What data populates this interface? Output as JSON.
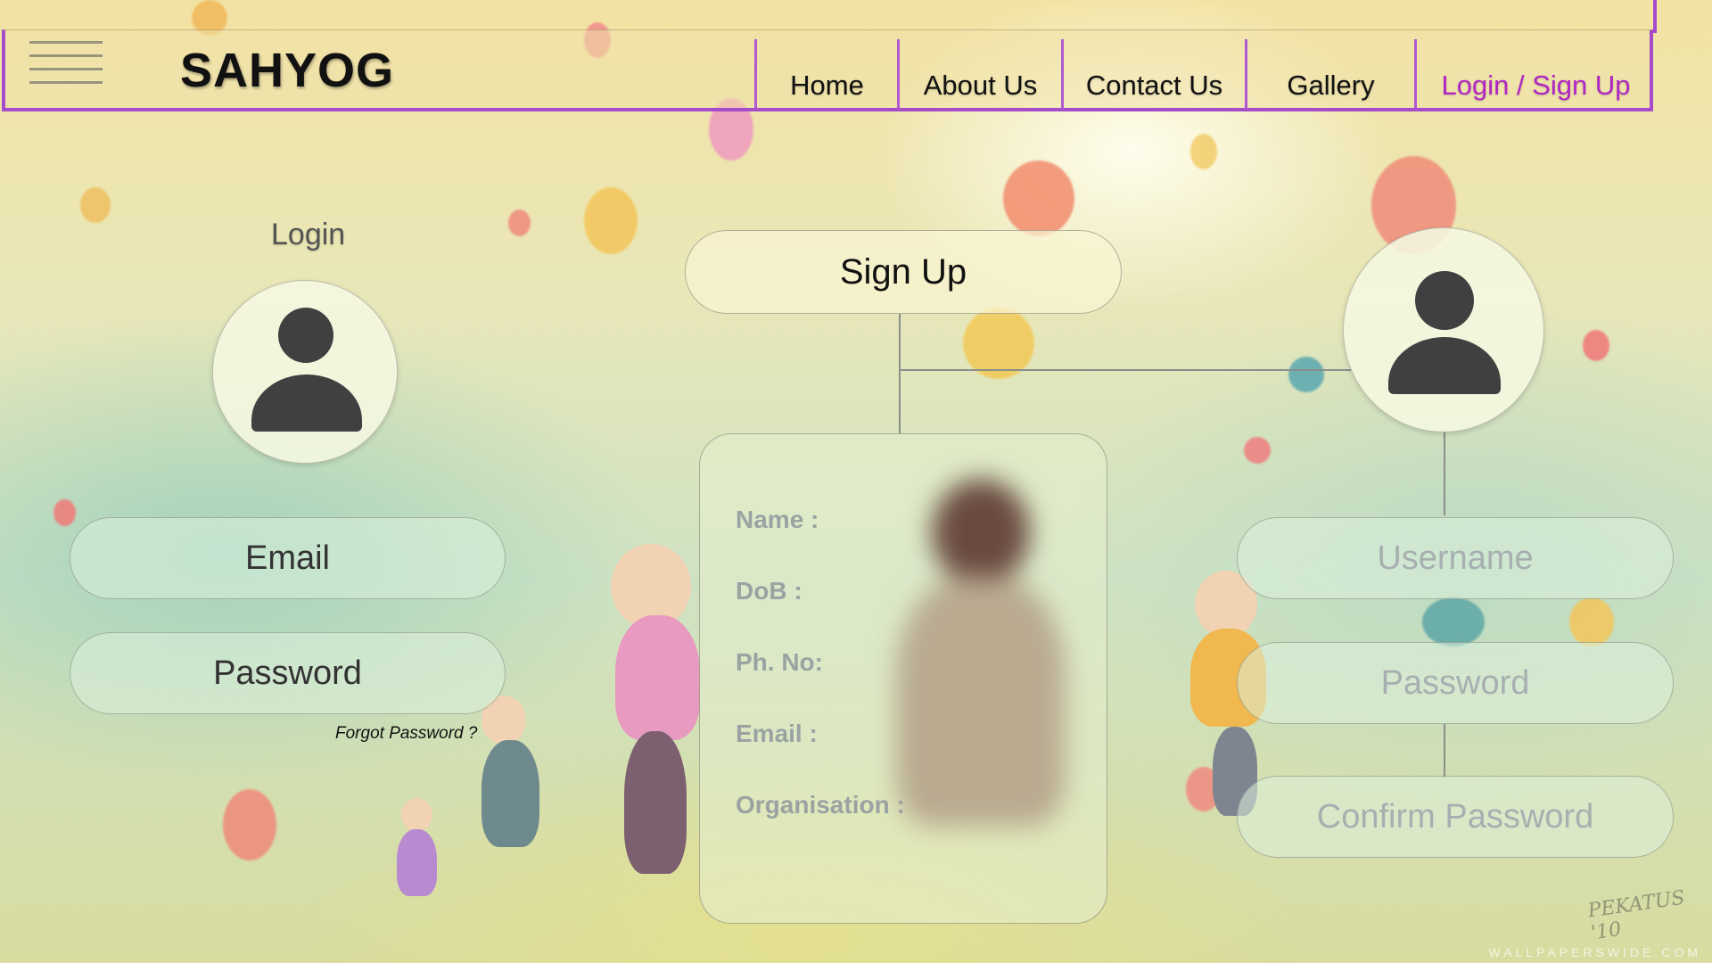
{
  "header": {
    "brand": "SAHYOG",
    "nav": [
      {
        "label": "Home"
      },
      {
        "label": "About Us"
      },
      {
        "label": "Contact Us"
      },
      {
        "label": "Gallery"
      },
      {
        "label": "Login / Sign Up",
        "active": true
      }
    ]
  },
  "login": {
    "title": "Login",
    "email_placeholder": "Email",
    "password_placeholder": "Password",
    "forgot_link": "Forgot Password ?"
  },
  "signup": {
    "title": "Sign Up",
    "fields": [
      {
        "label": "Name :"
      },
      {
        "label": "DoB     :"
      },
      {
        "label": "Ph. No:"
      },
      {
        "label": "Email  :"
      },
      {
        "label": "Organisation :"
      }
    ],
    "username_placeholder": "Username",
    "password_placeholder": "Password",
    "confirm_placeholder": "Confirm Password"
  },
  "background": {
    "watermark": "WALLPAPERSWIDE.COM",
    "artist_signature": "PEKATUS '10"
  },
  "colors": {
    "accent": "#a64bc9",
    "active_nav": "#b026c4",
    "avatar_icon": "#404040"
  }
}
